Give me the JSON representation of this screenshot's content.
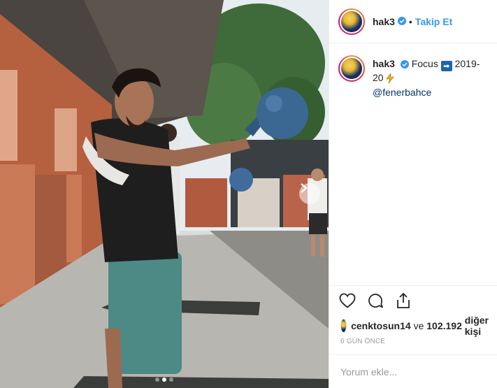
{
  "post": {
    "username": "hak3",
    "separator": "•",
    "follow_label": "Takip Et",
    "caption": {
      "username": "hak3",
      "text_before": "Focus",
      "arrow_emoji": "➡",
      "text_after": "2019-20",
      "mention": "@fenerbahce"
    },
    "likes": {
      "first_liker": "cenktosun14",
      "middle": "ve",
      "others_count": "102.192",
      "others_suffix": "diğer kişi"
    },
    "timestamp": "6 GÜN ÖNCE",
    "comment_placeholder": "Yorum ekle...",
    "carousel": {
      "total": 3,
      "active": 2
    },
    "icons": [
      "verified-badge-icon",
      "heart-icon",
      "comment-icon",
      "share-icon",
      "next-arrow-icon",
      "lightning-icon"
    ],
    "colors": {
      "link": "#3897f0",
      "mention": "#003569",
      "verified": "#3897f0",
      "muted": "#999999"
    }
  }
}
